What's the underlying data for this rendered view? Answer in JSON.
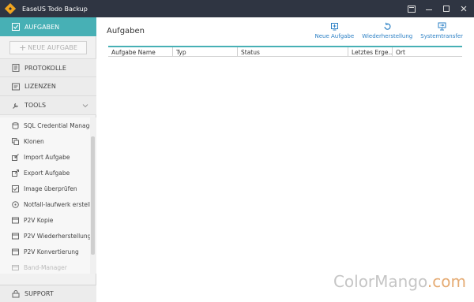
{
  "window": {
    "title": "EaseUS Todo Backup",
    "buttons": [
      "menu-icon",
      "minimize-icon",
      "maximize-icon",
      "close-icon"
    ]
  },
  "sidebar": {
    "tasks_label": "AUFGABEN",
    "new_task_label": "NEUE AUFGABE",
    "logs_label": "PROTOKOLLE",
    "licenses_label": "LIZENZEN",
    "tools_label": "TOOLS",
    "tools": [
      {
        "label": "SQL Credential Manager",
        "icon": "database-icon"
      },
      {
        "label": "Klonen",
        "icon": "clone-icon"
      },
      {
        "label": "Import Aufgabe",
        "icon": "import-icon"
      },
      {
        "label": "Export Aufgabe",
        "icon": "export-icon"
      },
      {
        "label": "Image überprüfen",
        "icon": "checkbox-icon"
      },
      {
        "label": "Notfall-laufwerk erstellen",
        "icon": "emergency-disk-icon"
      },
      {
        "label": "P2V Kopie",
        "icon": "p2v-copy-icon"
      },
      {
        "label": "P2V Wiederherstellung",
        "icon": "p2v-restore-icon"
      },
      {
        "label": "P2V Konvertierung",
        "icon": "p2v-convert-icon"
      },
      {
        "label": "Band-Manager",
        "icon": "tape-icon"
      }
    ],
    "support_label": "SUPPORT"
  },
  "main": {
    "title": "Aufgaben",
    "toolbar": {
      "new_task": "Neue Aufgabe",
      "restore": "Wiederherstellung",
      "system_transfer": "Systemtransfer"
    },
    "columns": [
      "Aufgabe Name",
      "Typ",
      "Status",
      "Letztes Erge...",
      "Ort"
    ]
  },
  "watermark": {
    "brand": "ColorMango",
    "suffix": ".com"
  },
  "colors": {
    "accent": "#47b0b5",
    "titlebar": "#2f3542",
    "link": "#2a7fc4"
  }
}
